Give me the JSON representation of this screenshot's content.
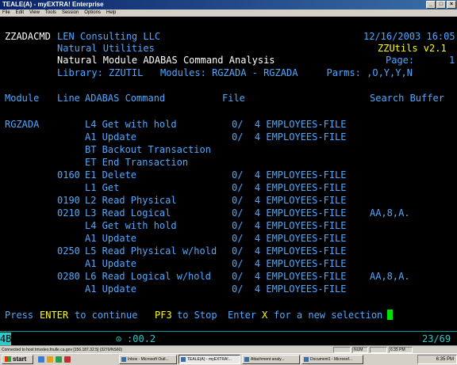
{
  "window": {
    "title": "TEALE(A) - myEXTRA! Enterprise"
  },
  "menu": {
    "items": [
      "File",
      "Edit",
      "View",
      "Tools",
      "Session",
      "Options",
      "Help"
    ]
  },
  "screen": {
    "header": {
      "program": "ZZADACMD",
      "company": "LEN Consulting LLC",
      "datetime": "12/16/2003 16:05",
      "subtitle1": "Natural Utilities",
      "product": "ZZUtils v2.1",
      "subtitle2": "Natural Module ADABAS Command Analysis",
      "page_label": "Page:",
      "page_value": "1",
      "library_line": "Library: ZZUTIL   Modules: RGZADA - RGZADA     Parms: ,O,Y,Y,N"
    },
    "columns": {
      "module": "Module",
      "line": "Line",
      "adabas_command": "ADABAS Command",
      "file": "File",
      "search_buffer": "Search Buffer"
    },
    "rows": [
      {
        "module": "RGZADA",
        "line": "",
        "cmd": "L4 Get with hold",
        "file": "0/  4 EMPLOYEES-FILE",
        "sb": ""
      },
      {
        "module": "",
        "line": "",
        "cmd": "A1 Update",
        "file": "0/  4 EMPLOYEES-FILE",
        "sb": ""
      },
      {
        "module": "",
        "line": "",
        "cmd": "BT Backout Transaction",
        "file": "",
        "sb": ""
      },
      {
        "module": "",
        "line": "",
        "cmd": "ET End Transaction",
        "file": "",
        "sb": ""
      },
      {
        "module": "",
        "line": "0160",
        "cmd": "E1 Delete",
        "file": "0/  4 EMPLOYEES-FILE",
        "sb": ""
      },
      {
        "module": "",
        "line": "",
        "cmd": "L1 Get",
        "file": "0/  4 EMPLOYEES-FILE",
        "sb": ""
      },
      {
        "module": "",
        "line": "0190",
        "cmd": "L2 Read Physical",
        "file": "0/  4 EMPLOYEES-FILE",
        "sb": ""
      },
      {
        "module": "",
        "line": "0210",
        "cmd": "L3 Read Logical",
        "file": "0/  4 EMPLOYEES-FILE",
        "sb": "AA,8,A."
      },
      {
        "module": "",
        "line": "",
        "cmd": "L4 Get with hold",
        "file": "0/  4 EMPLOYEES-FILE",
        "sb": ""
      },
      {
        "module": "",
        "line": "",
        "cmd": "A1 Update",
        "file": "0/  4 EMPLOYEES-FILE",
        "sb": ""
      },
      {
        "module": "",
        "line": "0250",
        "cmd": "L5 Read Physical w/hold",
        "file": "0/  4 EMPLOYEES-FILE",
        "sb": ""
      },
      {
        "module": "",
        "line": "",
        "cmd": "A1 Update",
        "file": "0/  4 EMPLOYEES-FILE",
        "sb": ""
      },
      {
        "module": "",
        "line": "0280",
        "cmd": "L6 Read Logical w/hold",
        "file": "0/  4 EMPLOYEES-FILE",
        "sb": "AA,8,A."
      },
      {
        "module": "",
        "line": "",
        "cmd": "A1 Update",
        "file": "0/  4 EMPLOYEES-FILE",
        "sb": ""
      }
    ],
    "footer": {
      "press": "Press",
      "enter_key": "ENTER",
      "to_continue": "to continue",
      "pf3_key": "PF3",
      "to_stop": "to Stop",
      "enter_word": "Enter",
      "x_key": "X",
      "for_new": "for a new selection"
    }
  },
  "oia": {
    "indicator": "4B",
    "timer": ":00.2",
    "cursor_pos": "23/69"
  },
  "statusbar": {
    "message": "Connected to host tmvsteo.fnulle.ca.gov [156.187.32.5] (3270/NS60)",
    "num": "NUM",
    "clock_field": "6:35 PM"
  },
  "taskbar": {
    "start_label": "start",
    "tasks": [
      "Inbox - Microsoft Outl...",
      "TEALE(A) - myEXTRA!...",
      "Attachment analy...",
      "Document1 - Microsof..."
    ],
    "clock": "6:35 PM"
  },
  "colors": {
    "terminal_bg": "#000000",
    "white_text": "#ffffff",
    "blue_text": "#4fa9ff",
    "yellow_text": "#ffff00",
    "cyan_text": "#30c8c8",
    "cursor": "#00e000"
  }
}
